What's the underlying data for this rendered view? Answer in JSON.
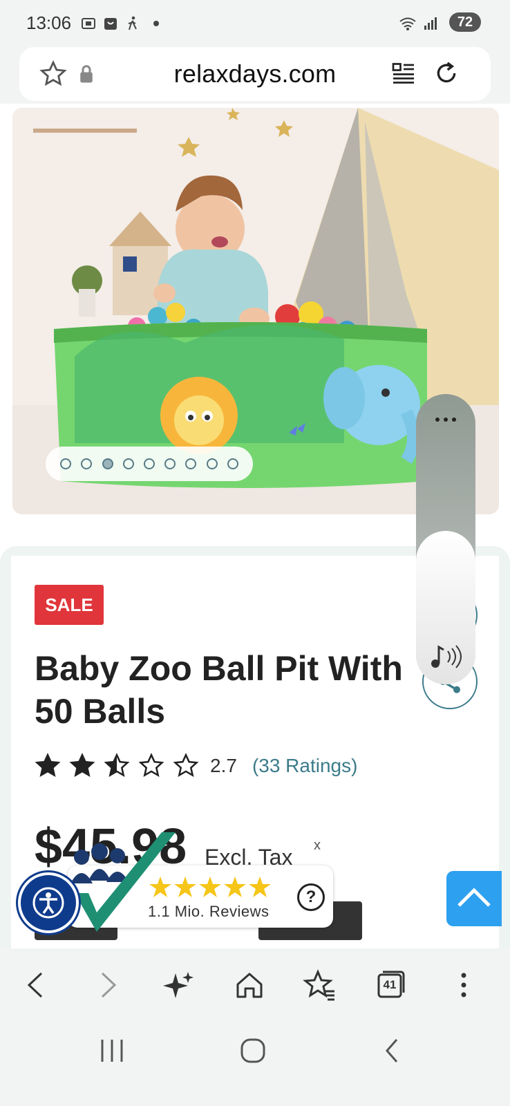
{
  "status_bar": {
    "time": "13:06",
    "battery": "72"
  },
  "browser": {
    "url": "relaxdays.com",
    "tab_count": "41"
  },
  "product": {
    "badge": "SALE",
    "title": "Baby Zoo Ball Pit With 50 Balls",
    "rating_value": "2.7",
    "rating_stars": 2.5,
    "rating_count": "(33 Ratings)",
    "price": "$45.98",
    "tax_note": "Excl. Tax",
    "tax_close": "x"
  },
  "gallery": {
    "dot_count": 9,
    "active_index": 2
  },
  "reviews_badge": {
    "text": "1.1 Mio. Reviews",
    "help": "?"
  },
  "colors": {
    "accent": "#3c7b8a",
    "sale": "#e0363b",
    "scroll_top": "#2da0f0",
    "accessibility": "#0f3b8c",
    "star_gold": "#f5c518"
  }
}
